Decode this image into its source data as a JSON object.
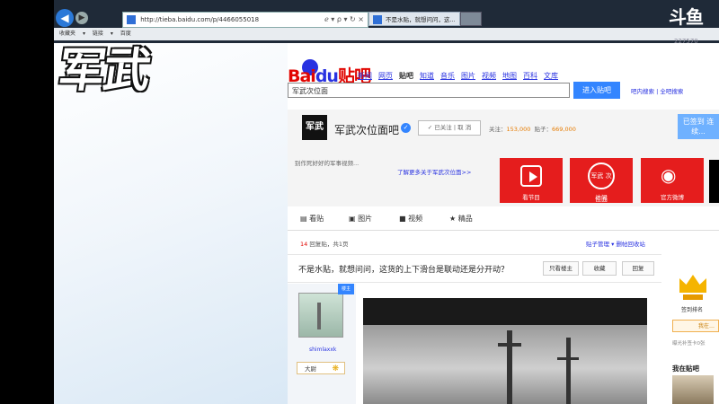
{
  "overlay": {
    "watermark": "军武",
    "stream_logo": "斗鱼",
    "room_id": "227570"
  },
  "browser": {
    "address_url": "http://tieba.baidu.com/p/4466055018",
    "address_controls": "ℯ ▾ ρ ▾ ↻ ×",
    "tab_active": "不是水贴，就想问问，这...",
    "favorites": [
      "收藏夹",
      "▾",
      "链接",
      "▾",
      "百度"
    ]
  },
  "site": {
    "logo_bai": "Bai",
    "logo_du": "du",
    "logo_tieba": "贴吧",
    "nav": [
      "新闻",
      "网页",
      "贴吧",
      "知道",
      "音乐",
      "图片",
      "视频",
      "地图",
      "百科",
      "文库"
    ],
    "nav_current_index": 2,
    "search_value": "军武次位面",
    "enter_button": "进入贴吧",
    "right_links": "吧内搜索 | 全吧搜索"
  },
  "forum": {
    "logo_text": "军武",
    "name": "军武次位面吧",
    "follow_button": "✓ 已关注 | 取 消",
    "stats_label_members": "关注：",
    "stats_members": "153,000",
    "stats_label_posts": "贴子：",
    "stats_posts": "669,000",
    "signin_button": "已签到 连续...",
    "slogan": "别作死好好的军事视频...",
    "more_link": "了解更多关于军武次位面>>",
    "tiles": [
      "看节目",
      "访问",
      "官方微博"
    ],
    "tile_circle": "军武 次位面"
  },
  "tabs": [
    "看贴",
    "图片",
    "视频",
    "精品"
  ],
  "thread": {
    "reply_count_label": "14",
    "reply_count_text": " 回复贴，共1页",
    "tools": "贴子管理 ▾   删帖回收站",
    "title": "不是水贴，就想问问，这货的上下滑台是联动还是分开动？",
    "btn_lz": "只看楼主",
    "btn_fav": "收藏",
    "btn_reply": "回复",
    "author_name": "shimlaxxk",
    "author_level": "大尉",
    "level_icon": "❋"
  },
  "right_panel": {
    "label1": "签到排名",
    "btn": "我在…",
    "muted": "曝光补签卡0张",
    "heading": "我在贴吧"
  }
}
